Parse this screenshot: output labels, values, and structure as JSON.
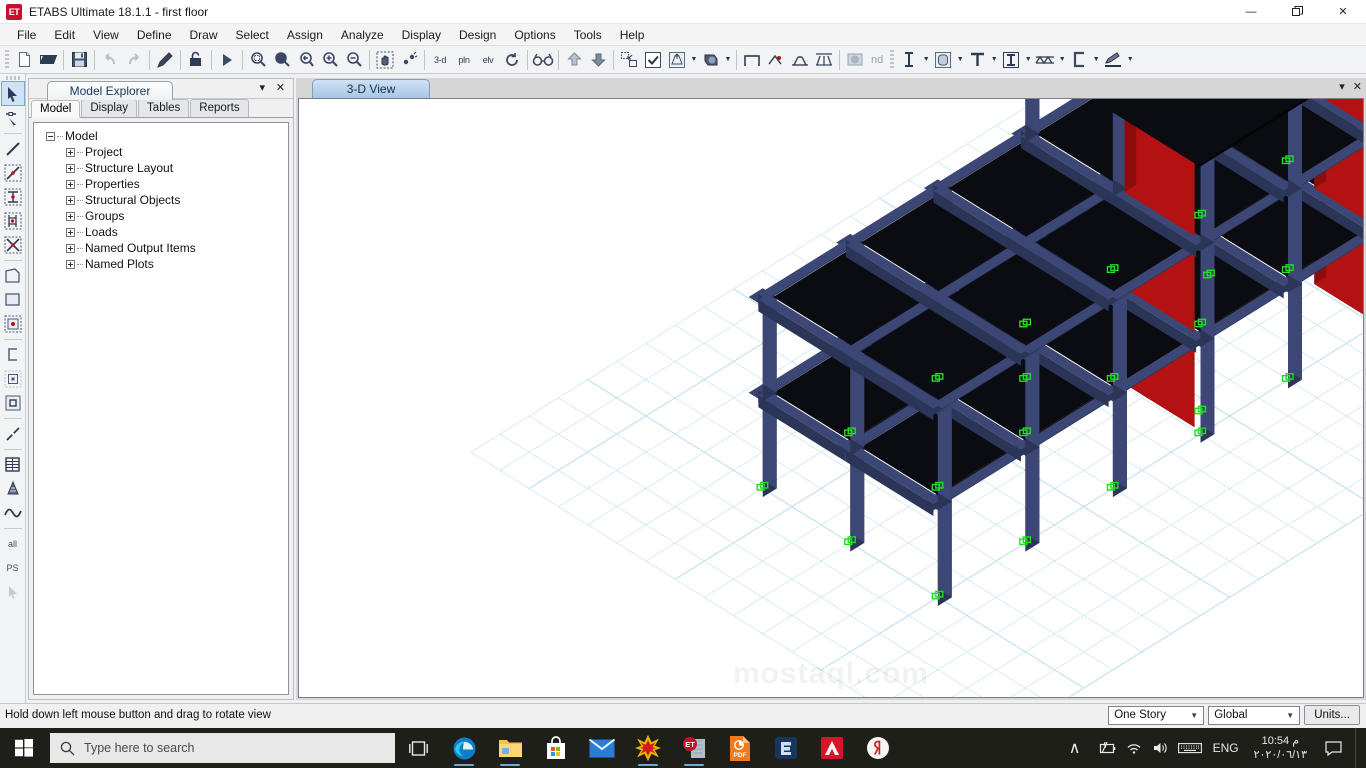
{
  "window": {
    "title": "ETABS Ultimate 18.1.1 - first floor",
    "logo_text": "ET",
    "minimize": "—",
    "restore": "❐",
    "close": "✕"
  },
  "menubar": {
    "items": [
      {
        "label": "File"
      },
      {
        "label": "Edit"
      },
      {
        "label": "View"
      },
      {
        "label": "Define"
      },
      {
        "label": "Draw"
      },
      {
        "label": "Select"
      },
      {
        "label": "Assign"
      },
      {
        "label": "Analyze"
      },
      {
        "label": "Display"
      },
      {
        "label": "Design"
      },
      {
        "label": "Options"
      },
      {
        "label": "Tools"
      },
      {
        "label": "Help"
      }
    ]
  },
  "toolbar": {
    "view_3d_label": "3-d",
    "plan_label": "pln",
    "elevation_label": "elv",
    "nd_label": "nd",
    "icons": [
      "new-file-icon",
      "open-file-icon",
      "save-icon",
      "undo-icon",
      "redo-icon",
      "edit-pen-icon",
      "lock-icon",
      "run-analysis-icon",
      "zoom-window-icon",
      "zoom-full-icon",
      "zoom-previous-icon",
      "zoom-in-icon",
      "zoom-out-icon",
      "pan-icon",
      "rubber-band-icon",
      "rotate-3d-icon",
      "glasses-icon",
      "move-up-icon",
      "move-down-icon",
      "select-all-icon",
      "check-icon",
      "extrude-cube-icon",
      "shading-icon",
      "frame-icon",
      "point-icon",
      "support-icon",
      "release-icon",
      "restraint-icon",
      "spring-icon",
      "area-icon",
      "section-i-icon",
      "section-box-icon",
      "section-t-icon",
      "section-wide-flange-icon",
      "section-truss-icon",
      "section-channel-icon",
      "draw-pen-icon"
    ]
  },
  "left_tools": {
    "icons": [
      "pointer-icon",
      "select-point-icon",
      "draw-line-icon",
      "draw-frame-icon",
      "draw-secondary-beam-icon",
      "draw-columns-icon",
      "draw-brace-icon",
      "draw-quad-area-icon",
      "draw-rect-area-icon",
      "draw-point-icon",
      "draw-wall-icon",
      "draw-dim-line-icon",
      "draw-grid-icon",
      "draw-ramp-icon",
      "draw-curve-icon"
    ],
    "all_label": "all",
    "ps_label": "PS"
  },
  "explorer": {
    "title": "Model Explorer",
    "collapse_icon": "▾",
    "close_icon": "✕",
    "tabs": [
      {
        "label": "Model",
        "active": true
      },
      {
        "label": "Display",
        "active": false
      },
      {
        "label": "Tables",
        "active": false
      },
      {
        "label": "Reports",
        "active": false
      }
    ],
    "tree": {
      "root": "Model",
      "children": [
        {
          "label": "Project"
        },
        {
          "label": "Structure Layout"
        },
        {
          "label": "Properties"
        },
        {
          "label": "Structural Objects"
        },
        {
          "label": "Groups"
        },
        {
          "label": "Loads"
        },
        {
          "label": "Named Output Items"
        },
        {
          "label": "Named Plots"
        }
      ]
    }
  },
  "view": {
    "tab_label": "3-D View",
    "collapse_icon": "▾",
    "close_icon": "✕",
    "watermark": "mostaql.com",
    "colors": {
      "frame": "#2b3558",
      "frame_light": "#3c4775",
      "slab": "#0b0b12",
      "wall": "#b41212",
      "wall_dark": "#8d0d0d",
      "support": "#1fe01f",
      "grid": "#bfe0ef",
      "background": "#ffffff"
    }
  },
  "statusbar": {
    "message": "Hold down left mouse button and drag to rotate view",
    "story_selector": "One Story",
    "coord_selector": "Global",
    "units_button": "Units..."
  },
  "taskbar": {
    "search_placeholder": "Type here to search",
    "apps": [
      {
        "name": "task-view-icon"
      },
      {
        "name": "edge-icon"
      },
      {
        "name": "file-explorer-icon"
      },
      {
        "name": "microsoft-store-icon"
      },
      {
        "name": "mail-icon"
      },
      {
        "name": "autodesk-3dsmax-icon"
      },
      {
        "name": "etabs-icon"
      },
      {
        "name": "pdf-icon"
      },
      {
        "name": "blue-app-icon"
      },
      {
        "name": "autodesk-icon"
      },
      {
        "name": "yandex-icon"
      }
    ],
    "tray": {
      "overflow_icon": "∧",
      "battery_icon": "battery-icon",
      "wifi_icon": "wifi-icon",
      "volume_icon": "volume-icon",
      "keyboard_icon": "keyboard-icon",
      "language": "ENG",
      "time": "10:54 م",
      "date": "٢٠٢٠/٠٦/١٣",
      "action_center_icon": "action-center-icon"
    }
  }
}
